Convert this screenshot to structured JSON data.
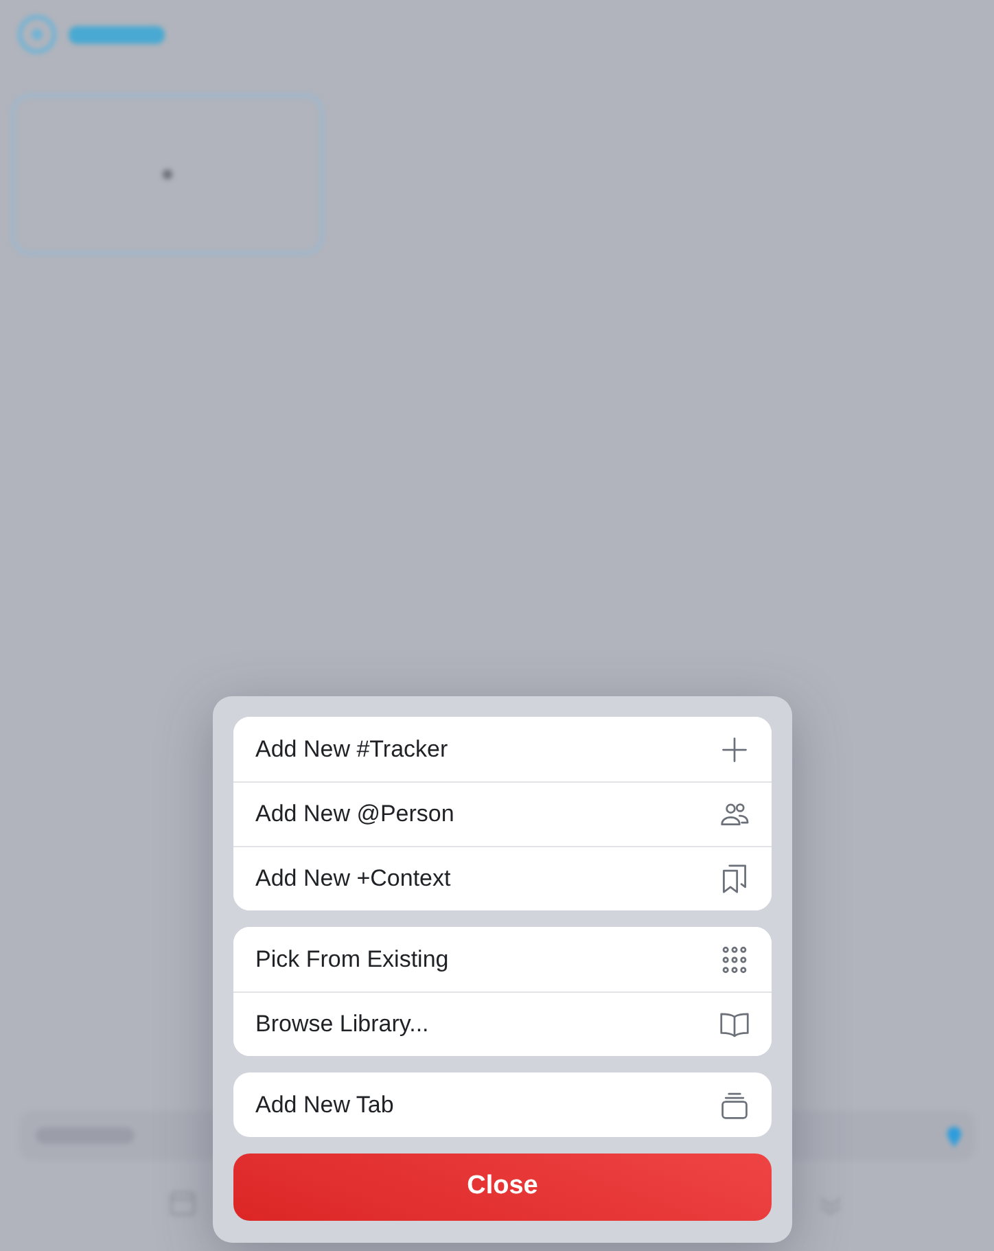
{
  "action_sheet": {
    "groups": [
      {
        "items": [
          {
            "label": "Add New #Tracker"
          },
          {
            "label": "Add New @Person"
          },
          {
            "label": "Add New +Context"
          }
        ]
      },
      {
        "items": [
          {
            "label": "Pick From Existing"
          },
          {
            "label": "Browse Library..."
          }
        ]
      },
      {
        "items": [
          {
            "label": "Add New Tab"
          }
        ]
      }
    ],
    "close_button": "Close"
  }
}
